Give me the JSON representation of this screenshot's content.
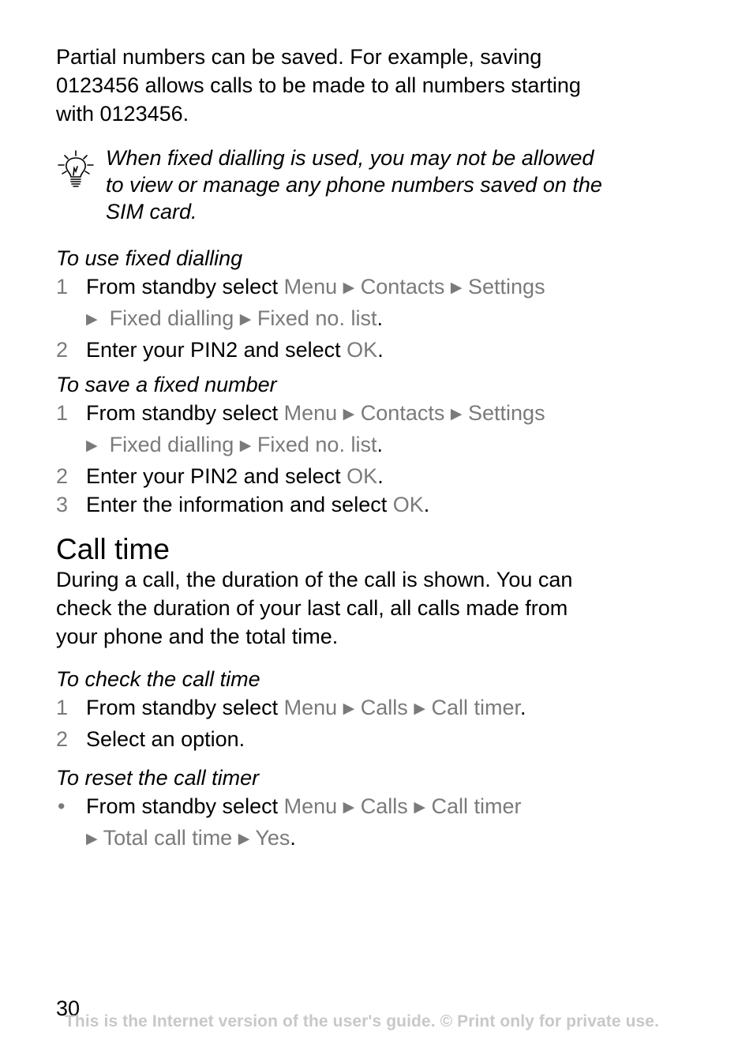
{
  "intro": {
    "lines": [
      "Partial numbers can be saved. For example, saving",
      "0123456 allows calls to be made to all numbers starting",
      "with 0123456."
    ]
  },
  "tip": {
    "icon": "lightbulb-icon",
    "lines": [
      "When fixed dialling is used, you may not be allowed",
      "to view or manage any phone numbers saved on the",
      "SIM card."
    ]
  },
  "arrow_glyph": "▶",
  "use_fixed": {
    "heading": "To use fixed dialling",
    "steps": [
      {
        "marker": "1",
        "prefix": "From standby select ",
        "path1": [
          "Menu",
          "Contacts",
          "Settings"
        ],
        "path2": [
          "Fixed dialling",
          "Fixed no. list"
        ],
        "suffix": "."
      },
      {
        "marker": "2",
        "prefix": "Enter your PIN2 and select ",
        "menu": "OK",
        "suffix": "."
      }
    ]
  },
  "save_fixed": {
    "heading": "To save a fixed number",
    "steps": [
      {
        "marker": "1",
        "prefix": "From standby select ",
        "path1": [
          "Menu",
          "Contacts",
          "Settings"
        ],
        "path2": [
          "Fixed dialling",
          "Fixed no. list"
        ],
        "suffix": "."
      },
      {
        "marker": "2",
        "prefix": "Enter your PIN2 and select ",
        "menu": "OK",
        "suffix": "."
      },
      {
        "marker": "3",
        "prefix": "Enter the information and select ",
        "menu": "OK",
        "suffix": "."
      }
    ]
  },
  "call_time": {
    "title": "Call time",
    "lines": [
      "During a call, the duration of the call is shown. You can",
      "check the duration of your last call, all calls made from",
      "your phone and the total time."
    ]
  },
  "check_call_time": {
    "heading": "To check the call time",
    "steps": [
      {
        "marker": "1",
        "prefix": "From standby select ",
        "path1": [
          "Menu",
          "Calls",
          "Call timer"
        ],
        "suffix": "."
      },
      {
        "marker": "2",
        "text": "Select an option."
      }
    ]
  },
  "reset_call_timer": {
    "heading": "To reset the call timer",
    "steps": [
      {
        "marker": "•",
        "prefix": "From standby select ",
        "path1": [
          "Menu",
          "Calls",
          "Call timer"
        ],
        "path2": [
          "Total call time",
          "Yes"
        ],
        "suffix": "."
      }
    ]
  },
  "footer": {
    "page_number": "30",
    "note": "This is the Internet version of the user's guide. © Print only for private use."
  }
}
